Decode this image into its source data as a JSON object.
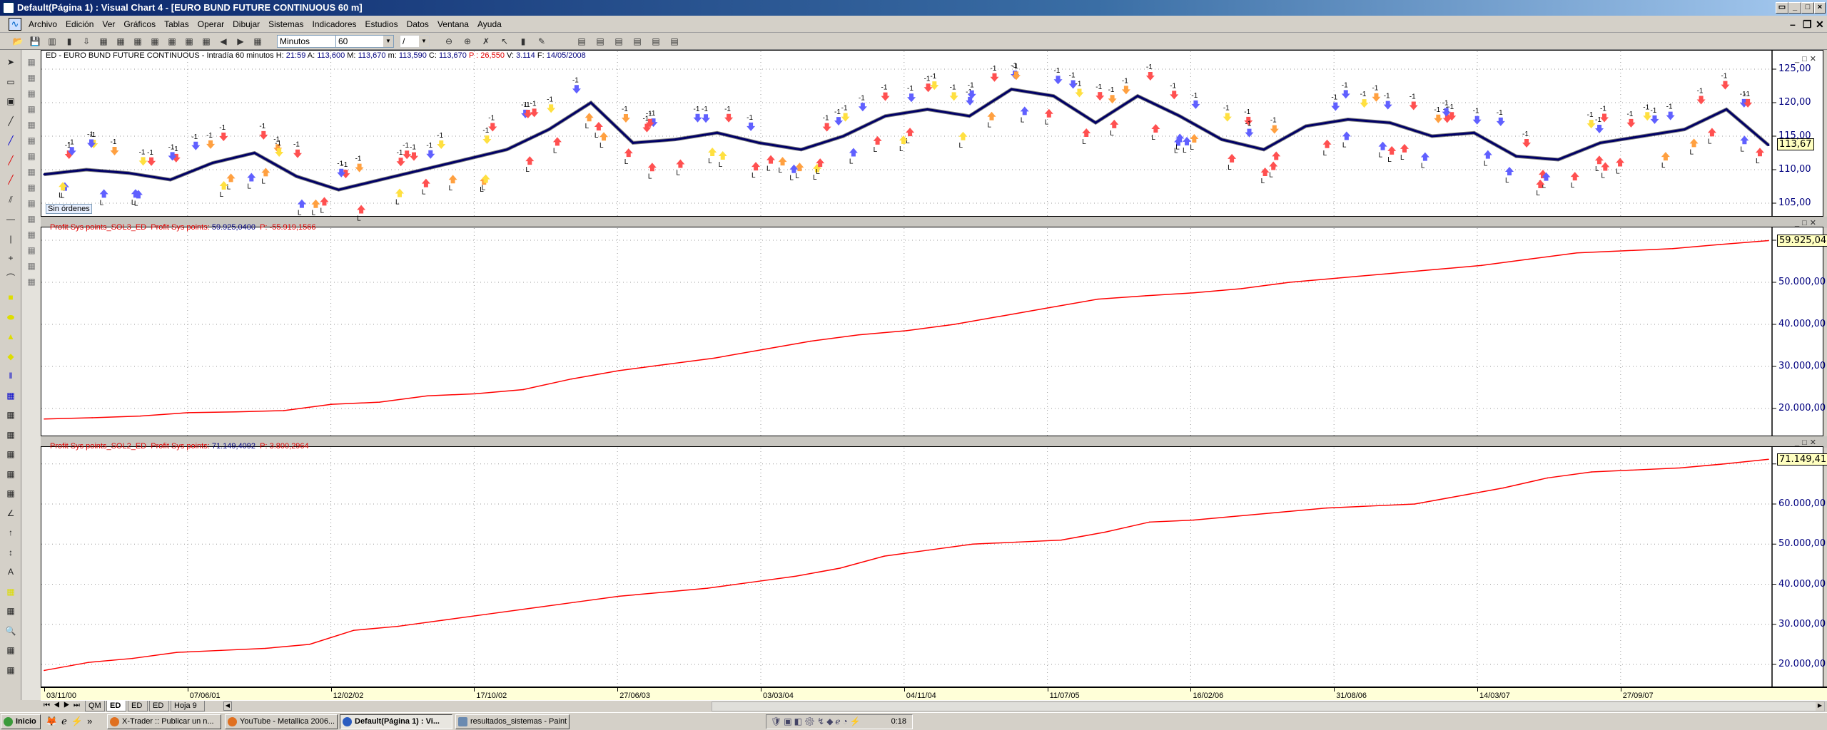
{
  "window": {
    "title": "Default(Página 1) : Visual Chart 4 - [EURO BUND FUTURE CONTINUOUS 60 m]"
  },
  "menu": [
    "Archivo",
    "Edición",
    "Ver",
    "Gráficos",
    "Tablas",
    "Operar",
    "Dibujar",
    "Sistemas",
    "Indicadores",
    "Estudios",
    "Datos",
    "Ventana",
    "Ayuda"
  ],
  "toolbar": {
    "left_icons": [
      "open-folder-icon",
      "save-icon",
      "save-all-icon",
      "bar-chart-icon",
      "chart-download-icon",
      "folder-chart-icon",
      "folder-chart-2-icon",
      "folder-chart-3-icon",
      "system-icon",
      "euro-key-icon",
      "edit-chart-icon",
      "properties-icon",
      "scroll-left-icon",
      "scroll-right-icon",
      "tree-icon"
    ],
    "timeframe_unit": "Minutos",
    "timeframe_value": "60",
    "draw_style": "/",
    "right_icons": [
      "zoom-out-icon",
      "zoom-in-icon",
      "indicator-icon",
      "cursor-icon",
      "marker-icon",
      "pen-icon",
      "window-1-icon",
      "window-2-icon",
      "window-3-icon",
      "window-4-icon",
      "window-5-icon",
      "window-6-icon"
    ]
  },
  "left_tools_col1": [
    "select-arrow-icon",
    "ruler-icon",
    "rectangle-fill-icon",
    "line-icon",
    "blue-line-icon",
    "red-line-icon",
    "red-blue-line-icon",
    "parallel-lines-icon",
    "horizontal-line-icon",
    "vertical-line-icon",
    "crosshair-icon",
    "curve-icon",
    "square-icon",
    "ellipse-icon",
    "triangle-icon",
    "diamond-icon",
    "vertical-bars-icon",
    "grid-bars-icon",
    "fan-icon",
    "box-icon",
    "bars-icon",
    "arrow-icon",
    "fibonacci-icon",
    "angle-icon",
    "up-arrow-icon",
    "up-down-arrow-icon",
    "text-icon",
    "yellow-box-icon",
    "quad-icon",
    "search-icon",
    "gallery-icon",
    "color-icon"
  ],
  "left_tools_col2": [
    "panel-icon",
    "layers-icon",
    "grid-icon",
    "circle-grid-icon",
    "eye-icon",
    "pointer-icon",
    "diamond-gray-icon",
    "diamond-dot-icon",
    "diamond-dot-2-icon",
    "block-icon",
    "hatched-block-icon",
    "dark-block-icon",
    "terminal-icon",
    "weight-icon",
    "cross-box-icon"
  ],
  "pane1": {
    "header_prefix": "ED - EURO BUND FUTURE CONTINUOUS - Intradía 60 minutos",
    "fields": [
      {
        "label": "H:",
        "value": "21:59"
      },
      {
        "label": "A:",
        "value": "113,600"
      },
      {
        "label": "M:",
        "value": "113,670"
      },
      {
        "label": "m:",
        "value": "113,590"
      },
      {
        "label": "C:",
        "value": "113,670"
      },
      {
        "label": "P :",
        "value": "26,550",
        "red": true
      },
      {
        "label": "V:",
        "value": "3.114"
      },
      {
        "label": "F:",
        "value": "14/05/2008"
      }
    ],
    "status_label": "Sin órdenes",
    "last_value": "113,67",
    "axis_labels": [
      "125,00",
      "120,00",
      "115,00",
      "110,00",
      "105,00"
    ]
  },
  "pane2": {
    "name": "Profit Sys points_SOL3_ED",
    "indicator": "Profit Sys points:",
    "value": "59.925,0400",
    "p": "P: -55.919,1566",
    "last_value": "59.925,04",
    "axis_labels": [
      "50.000,00",
      "40.000,00",
      "30.000,00",
      "20.000,00"
    ]
  },
  "pane3": {
    "name": "Profit Sys points_SOL2_ED",
    "indicator": "Profit Sys points:",
    "value": "71.149,4092",
    "p": "P: 3.800,2964",
    "last_value": "71.149,41",
    "axis_labels": [
      "60.000,00",
      "50.000,00",
      "40.000,00",
      "30.000,00",
      "20.000,00"
    ]
  },
  "xaxis": {
    "labels": [
      "03/11/00",
      "07/06/01",
      "12/02/02",
      "17/10/02",
      "27/06/03",
      "03/03/04",
      "04/11/04",
      "11/07/05",
      "16/02/06",
      "31/08/06",
      "14/03/07",
      "27/09/07"
    ]
  },
  "tabs": [
    "QM",
    "ED",
    "ED",
    "ED",
    "Hoja 9"
  ],
  "taskbar": {
    "start": "Inicio",
    "tasks": [
      "X-Trader :: Publicar un n...",
      "YouTube - Metallica 2006...",
      "Default(Página 1) : Vi...",
      "resultados_sistemas - Paint"
    ],
    "clock": "0:18"
  },
  "colors": {
    "price": "#000066",
    "equity": "#ff0000",
    "axis_text": "#00007f",
    "titlebar": "#0a246a"
  },
  "chart_data": [
    {
      "type": "line",
      "title": "ED - EURO BUND FUTURE CONTINUOUS - Intradía 60 minutos",
      "x_start": 2000.84,
      "x_end": 2008.37,
      "ylim": [
        103,
        126
      ],
      "values": [
        109.3,
        110,
        109.5,
        108.5,
        111,
        112.5,
        109,
        107,
        108.5,
        110,
        111.5,
        113,
        116,
        120,
        114,
        114.5,
        115.5,
        114,
        113,
        115,
        118,
        119,
        118,
        122,
        121,
        117,
        121,
        118,
        114.5,
        113,
        116.5,
        117.5,
        117,
        115,
        115.5,
        112,
        111.5,
        114,
        115,
        116,
        119,
        113.67
      ]
    },
    {
      "type": "line",
      "title": "Profit Sys points_SOL3_ED",
      "x_start": 2000.84,
      "x_end": 2008.37,
      "ylim": [
        14000,
        62000
      ],
      "values": [
        17500,
        17800,
        18200,
        19000,
        19200,
        19500,
        21000,
        21500,
        23000,
        23500,
        24500,
        27000,
        29000,
        30500,
        32000,
        34000,
        36000,
        37500,
        38500,
        40000,
        42000,
        44000,
        46000,
        46800,
        47500,
        48500,
        50000,
        51000,
        52000,
        53000,
        54000,
        55500,
        57000,
        57500,
        58000,
        59000,
        59925
      ]
    },
    {
      "type": "line",
      "title": "Profit Sys points_SOL2_ED",
      "x_start": 2000.84,
      "x_end": 2008.37,
      "ylim": [
        15000,
        74000
      ],
      "values": [
        18500,
        20500,
        21500,
        23000,
        23500,
        24000,
        25000,
        28500,
        29500,
        31000,
        32500,
        34000,
        35500,
        37000,
        38000,
        39000,
        40500,
        42000,
        44000,
        47000,
        48500,
        50000,
        50500,
        51000,
        53000,
        55500,
        56000,
        57000,
        58000,
        59000,
        59500,
        60000,
        62000,
        64000,
        66500,
        68000,
        68500,
        69000,
        70000,
        71149
      ]
    }
  ]
}
